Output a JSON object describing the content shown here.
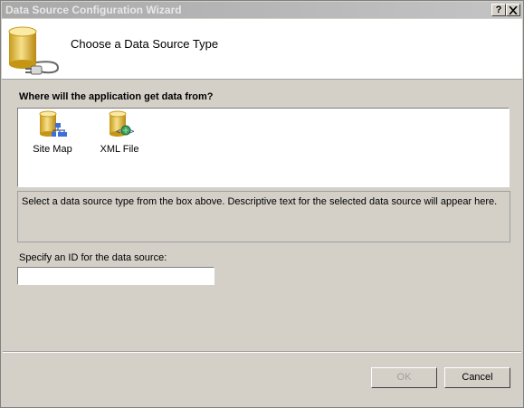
{
  "window": {
    "title": "Data Source Configuration Wizard",
    "help_label": "?",
    "close_label": "X"
  },
  "header": {
    "title": "Choose a Data Source Type",
    "icon": "database-plug-icon"
  },
  "source_section": {
    "label": "Where will the application get data from?",
    "items": [
      {
        "label": "Site Map",
        "icon": "sitemap-database-icon"
      },
      {
        "label": "XML File",
        "icon": "xml-database-icon"
      }
    ],
    "description": "Select a data source type from the box above. Descriptive text for the selected data source will appear here."
  },
  "id_field": {
    "label": "Specify an ID for the data source:",
    "value": ""
  },
  "buttons": {
    "ok": "OK",
    "cancel": "Cancel"
  },
  "colors": {
    "dialog_bg": "#d4d0c8",
    "titlebar": "#a9a9a9",
    "header_bg": "#ffffff"
  }
}
